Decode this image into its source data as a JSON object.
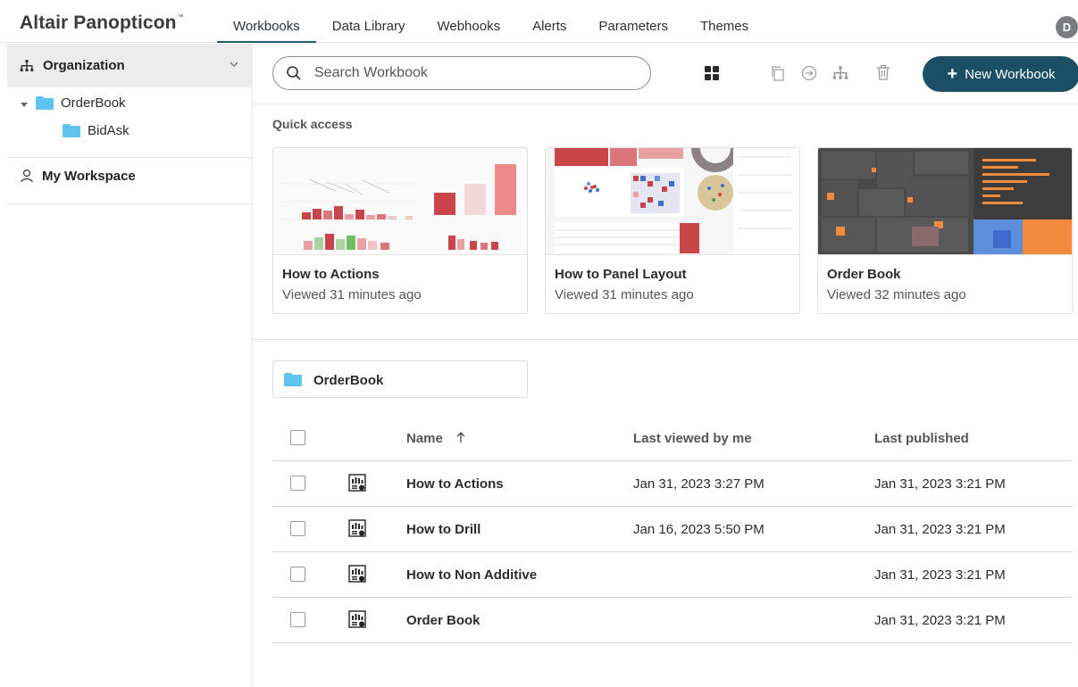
{
  "app": {
    "logo": "Altair Panopticon",
    "logo_tm": "™",
    "user_initial": "D"
  },
  "nav": {
    "tabs": [
      {
        "label": "Workbooks",
        "active": true
      },
      {
        "label": "Data Library",
        "active": false
      },
      {
        "label": "Webhooks",
        "active": false
      },
      {
        "label": "Alerts",
        "active": false
      },
      {
        "label": "Parameters",
        "active": false
      },
      {
        "label": "Themes",
        "active": false
      }
    ]
  },
  "sidebar": {
    "organization_label": "Organization",
    "tree": [
      {
        "label": "OrderBook",
        "expanded": true
      },
      {
        "label": "BidAsk"
      }
    ],
    "workspace_label": "My Workspace"
  },
  "toolbar": {
    "search_placeholder": "Search Workbook",
    "new_button_label": "New Workbook"
  },
  "quick_access": {
    "title": "Quick access",
    "cards": [
      {
        "title": "How to Actions",
        "subtitle": "Viewed 31 minutes ago"
      },
      {
        "title": "How to Panel Layout",
        "subtitle": "Viewed 31 minutes ago"
      },
      {
        "title": "Order Book",
        "subtitle": "Viewed 32 minutes ago"
      }
    ]
  },
  "folder": {
    "label": "OrderBook"
  },
  "table": {
    "headers": {
      "name": "Name",
      "last_viewed": "Last viewed by me",
      "last_published": "Last published"
    },
    "rows": [
      {
        "name": "How to Actions",
        "last_viewed": "Jan 31, 2023 3:27 PM",
        "last_published": "Jan 31, 2023 3:21 PM"
      },
      {
        "name": "How to Drill",
        "last_viewed": "Jan 16, 2023 5:50 PM",
        "last_published": "Jan 31, 2023 3:21 PM"
      },
      {
        "name": "How to Non Additive",
        "last_viewed": "",
        "last_published": "Jan 31, 2023 3:21 PM"
      },
      {
        "name": "Order Book",
        "last_viewed": "",
        "last_published": "Jan 31, 2023 3:21 PM"
      }
    ]
  },
  "colors": {
    "accent": "#1a4f66",
    "folder": "#5ec3ee",
    "avatar": "#7a7c80"
  }
}
